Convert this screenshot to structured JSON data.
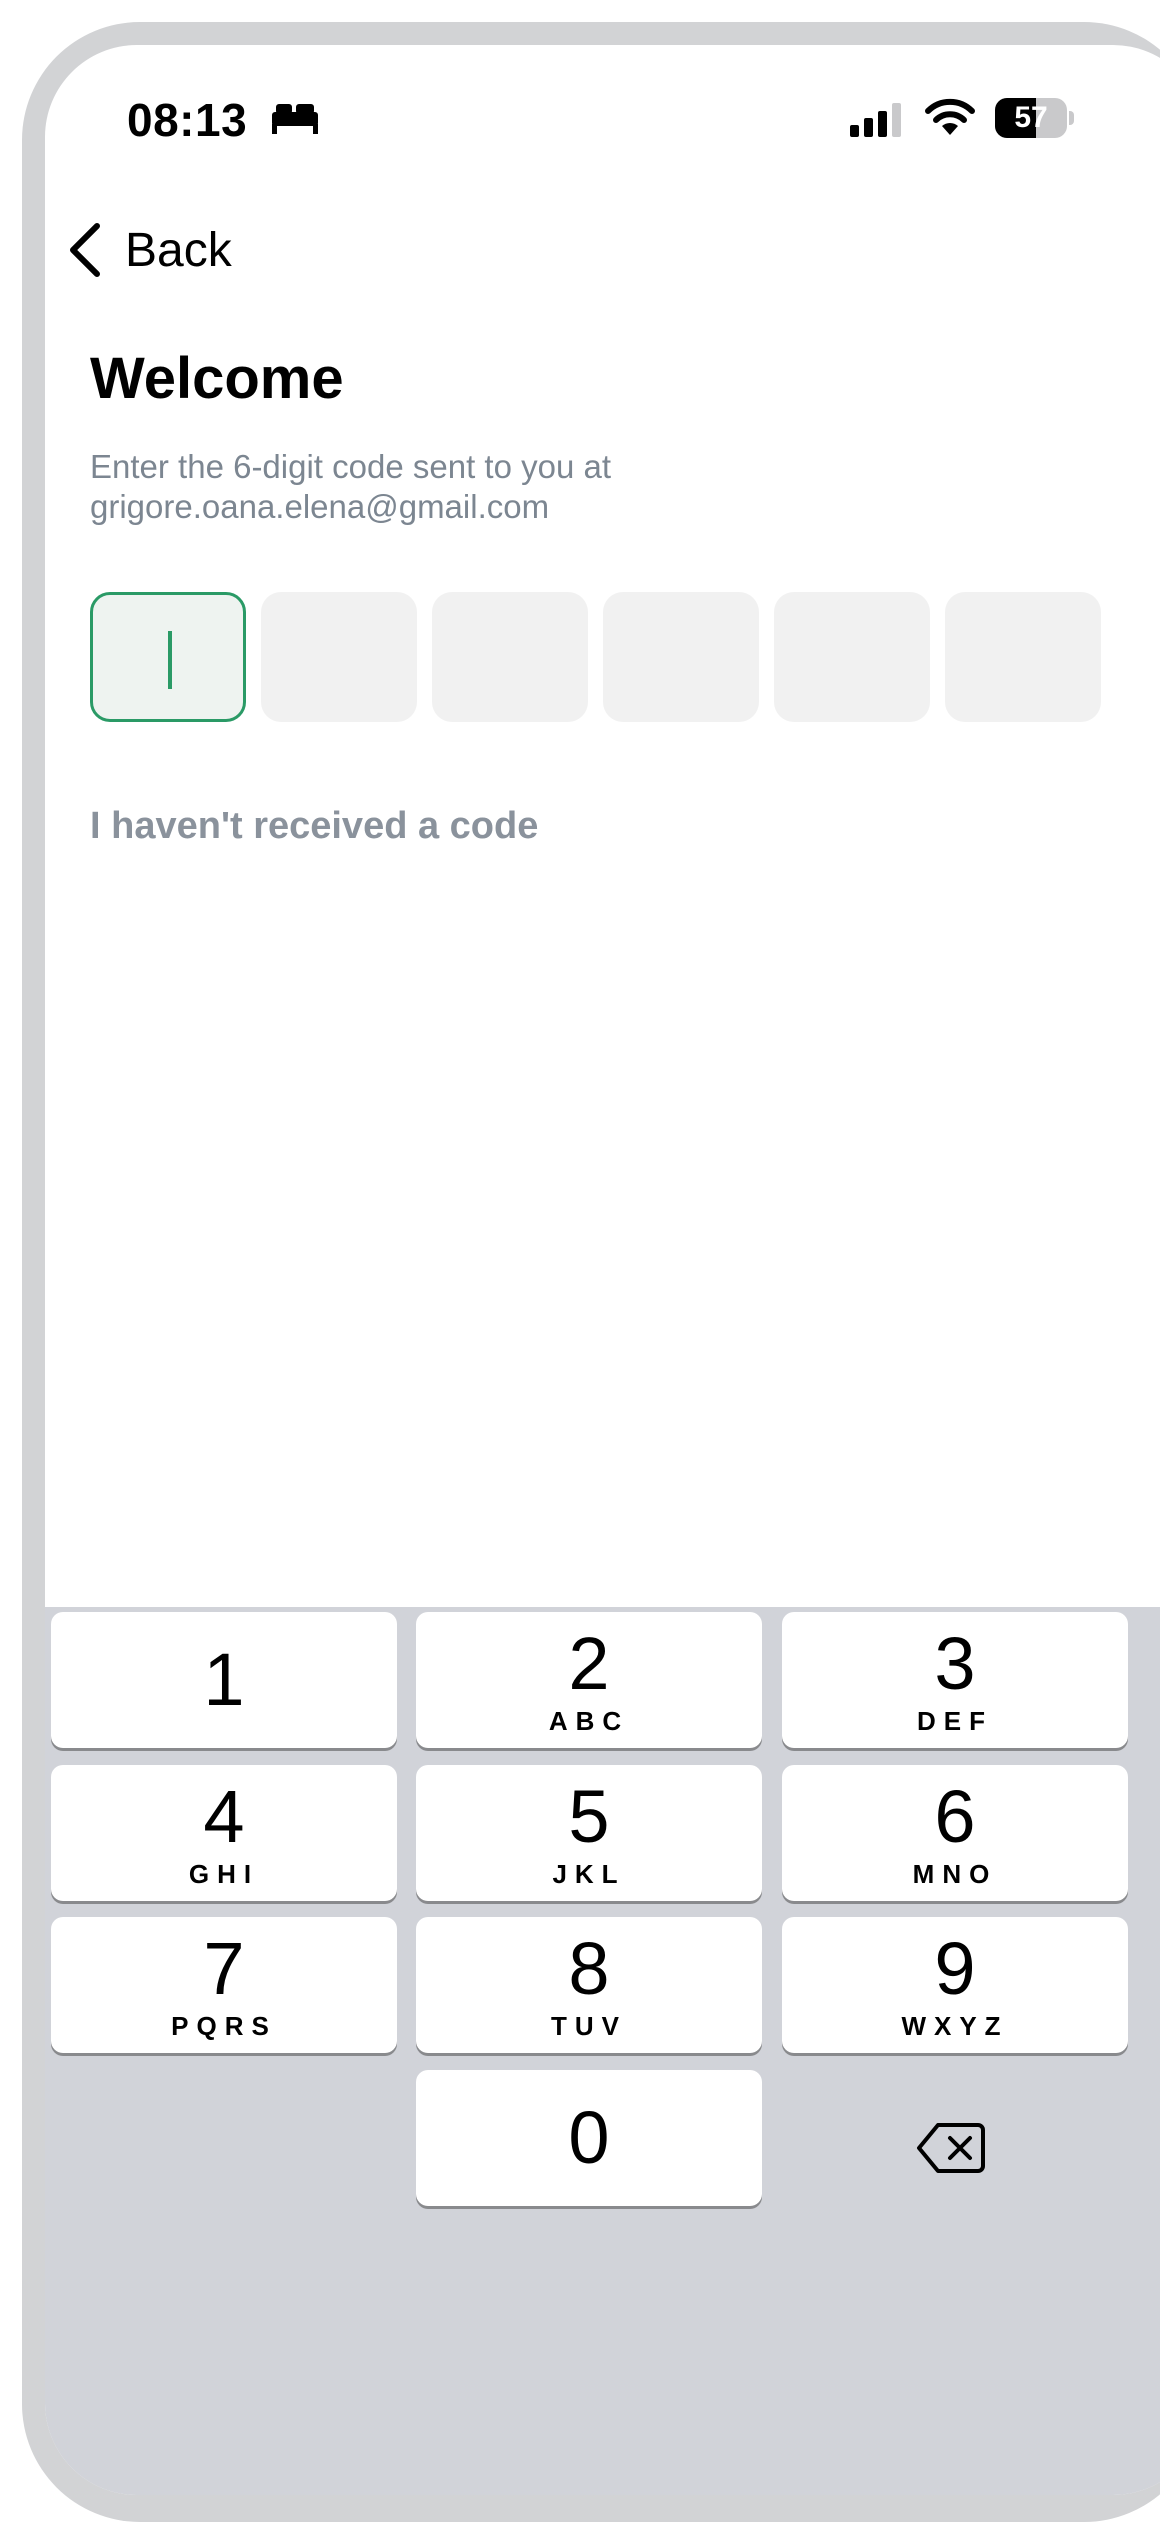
{
  "status_bar": {
    "time": "08:13",
    "focus_icon": "bed-icon",
    "signal_icon": "cellular-signal-icon",
    "wifi_icon": "wifi-icon",
    "battery_level": "57",
    "battery_fraction": 0.57
  },
  "nav": {
    "back_label": "Back"
  },
  "header": {
    "title": "Welcome",
    "subtitle_line1": "Enter the 6-digit code sent to you at",
    "subtitle_line2": "grigore.oana.elena@gmail.com"
  },
  "code_input": {
    "digits": [
      "",
      "",
      "",
      "",
      "",
      ""
    ],
    "active_index": 0,
    "accent_color": "#2a9a66"
  },
  "resend": {
    "label": "I haven't received a code"
  },
  "keypad": {
    "keys": [
      {
        "digit": "1",
        "letters": ""
      },
      {
        "digit": "2",
        "letters": "ABC"
      },
      {
        "digit": "3",
        "letters": "DEF"
      },
      {
        "digit": "4",
        "letters": "GHI"
      },
      {
        "digit": "5",
        "letters": "JKL"
      },
      {
        "digit": "6",
        "letters": "MNO"
      },
      {
        "digit": "7",
        "letters": "PQRS"
      },
      {
        "digit": "8",
        "letters": "TUV"
      },
      {
        "digit": "9",
        "letters": "WXYZ"
      },
      {
        "digit": "0",
        "letters": ""
      }
    ],
    "delete_icon": "backspace-icon"
  }
}
